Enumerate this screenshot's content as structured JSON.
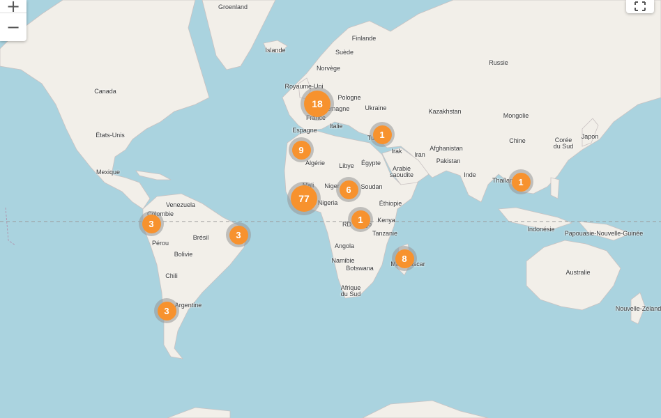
{
  "map": {
    "colors": {
      "ocean": "#aad3df",
      "land": "#f2efe9",
      "border": "#c9c2c2",
      "equator": "#999999",
      "cluster_fill": "#f7922e",
      "cluster_halo": "#969696"
    },
    "controls": {
      "zoom_in_label": "+",
      "zoom_out_label": "−",
      "zoom_in_icon": "plus-icon",
      "zoom_out_icon": "minus-icon",
      "fullscreen_icon": "fullscreen-icon"
    },
    "labels": [
      {
        "id": "groenland",
        "text": "Groenland"
      },
      {
        "id": "islande",
        "text": "Islande"
      },
      {
        "id": "finlande",
        "text": "Finlande"
      },
      {
        "id": "suede",
        "text": "Suède"
      },
      {
        "id": "norvege",
        "text": "Norvège"
      },
      {
        "id": "russie",
        "text": "Russie"
      },
      {
        "id": "canada",
        "text": "Canada"
      },
      {
        "id": "royaume-uni",
        "text": "Royaume-Uni"
      },
      {
        "id": "pologne",
        "text": "Pologne"
      },
      {
        "id": "allemagne",
        "text": "Allemagne"
      },
      {
        "id": "ukraine",
        "text": "Ukraine"
      },
      {
        "id": "france",
        "text": "France"
      },
      {
        "id": "kazakhstan",
        "text": "Kazakhstan"
      },
      {
        "id": "mongolie",
        "text": "Mongolie"
      },
      {
        "id": "italie",
        "text": "Italie"
      },
      {
        "id": "espagne",
        "text": "Espagne"
      },
      {
        "id": "turquie",
        "text": "Turquie"
      },
      {
        "id": "etats-unis",
        "text": "États-Unis"
      },
      {
        "id": "chine",
        "text": "Chine"
      },
      {
        "id": "coree-du-sud",
        "text": "Corée\ndu Sud"
      },
      {
        "id": "japon",
        "text": "Japon"
      },
      {
        "id": "irak",
        "text": "Irak"
      },
      {
        "id": "iran",
        "text": "Iran"
      },
      {
        "id": "afghanistan",
        "text": "Afghanistan"
      },
      {
        "id": "algerie",
        "text": "Algérie"
      },
      {
        "id": "libye",
        "text": "Libye"
      },
      {
        "id": "egypte",
        "text": "Égypte"
      },
      {
        "id": "pakistan",
        "text": "Pakistan"
      },
      {
        "id": "arabie-saoudite",
        "text": "Arabie\nsaoudite"
      },
      {
        "id": "mexique",
        "text": "Mexique"
      },
      {
        "id": "inde",
        "text": "Inde"
      },
      {
        "id": "thailande",
        "text": "Thaïlande"
      },
      {
        "id": "mali",
        "text": "Mali"
      },
      {
        "id": "niger",
        "text": "Niger"
      },
      {
        "id": "soudan",
        "text": "Soudan"
      },
      {
        "id": "venezuela",
        "text": "Venezuela"
      },
      {
        "id": "nigeria",
        "text": "Nigeria"
      },
      {
        "id": "ethiopie",
        "text": "Éthiopie"
      },
      {
        "id": "colombie",
        "text": "Colombie"
      },
      {
        "id": "rd-congo",
        "text": "RD Congo"
      },
      {
        "id": "kenya",
        "text": "Kenya"
      },
      {
        "id": "indonesie",
        "text": "Indonésie"
      },
      {
        "id": "papouasie",
        "text": "Papouasie-Nouvelle-Guinée"
      },
      {
        "id": "tanzanie",
        "text": "Tanzanie"
      },
      {
        "id": "bresil",
        "text": "Brésil"
      },
      {
        "id": "perou",
        "text": "Pérou"
      },
      {
        "id": "angola",
        "text": "Angola"
      },
      {
        "id": "bolivie",
        "text": "Bolivie"
      },
      {
        "id": "namibie",
        "text": "Namibie"
      },
      {
        "id": "madagascar",
        "text": "Madagascar"
      },
      {
        "id": "botswana",
        "text": "Botswana"
      },
      {
        "id": "australie",
        "text": "Australie"
      },
      {
        "id": "chili",
        "text": "Chili"
      },
      {
        "id": "afrique-du-sud",
        "text": "Afrique\ndu Sud"
      },
      {
        "id": "argentine",
        "text": "Argentine"
      },
      {
        "id": "nouvelle-zelande",
        "text": "Nouvelle-Zélande"
      }
    ],
    "clusters": [
      {
        "id": "europe-west",
        "count": "18"
      },
      {
        "id": "turkey",
        "count": "1"
      },
      {
        "id": "algeria",
        "count": "9"
      },
      {
        "id": "sudan",
        "count": "6"
      },
      {
        "id": "west-africa",
        "count": "77"
      },
      {
        "id": "thailand",
        "count": "1"
      },
      {
        "id": "colombia",
        "count": "3"
      },
      {
        "id": "brazil-east",
        "count": "3"
      },
      {
        "id": "congo",
        "count": "1"
      },
      {
        "id": "madagascar",
        "count": "8"
      },
      {
        "id": "argentina",
        "count": "3"
      }
    ]
  }
}
